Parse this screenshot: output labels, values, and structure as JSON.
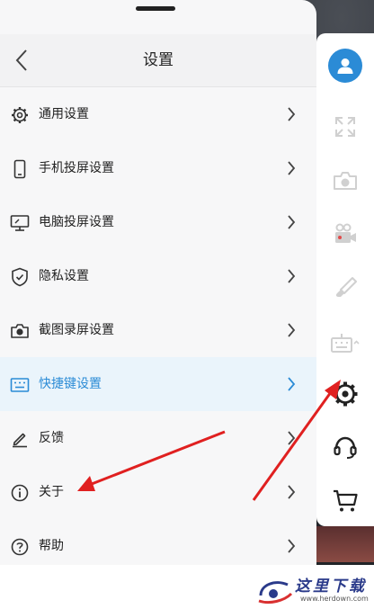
{
  "header": {
    "title": "设置",
    "back_icon": "chevron-left-icon"
  },
  "settings": {
    "items": [
      {
        "label": "通用设置",
        "icon": "gear-icon"
      },
      {
        "label": "手机投屏设置",
        "icon": "phone-icon"
      },
      {
        "label": "电脑投屏设置",
        "icon": "monitor-icon"
      },
      {
        "label": "隐私设置",
        "icon": "shield-check-icon"
      },
      {
        "label": "截图录屏设置",
        "icon": "camera-icon"
      },
      {
        "label": "快捷键设置",
        "icon": "keyboard-icon",
        "selected": true
      },
      {
        "label": "反馈",
        "icon": "pen-icon"
      },
      {
        "label": "关于",
        "icon": "info-icon"
      },
      {
        "label": "帮助",
        "icon": "question-icon"
      }
    ]
  },
  "toolbar": {
    "items": [
      {
        "icon": "avatar-user-icon"
      },
      {
        "icon": "fullscreen-icon"
      },
      {
        "icon": "camera-icon"
      },
      {
        "icon": "video-record-icon"
      },
      {
        "icon": "paint-brush-icon"
      },
      {
        "icon": "keyboard-icon"
      },
      {
        "icon": "gear-icon",
        "highlighted": true
      },
      {
        "icon": "headset-icon"
      },
      {
        "icon": "cart-icon"
      }
    ]
  },
  "watermark": {
    "cn": "这里下载",
    "en": "www.herdown.com"
  },
  "colors": {
    "accent": "#2b8bd6",
    "annotation": "#e02020",
    "selected_row_bg": "#eaf4fb",
    "panel_bg": "#f7f7f8"
  }
}
